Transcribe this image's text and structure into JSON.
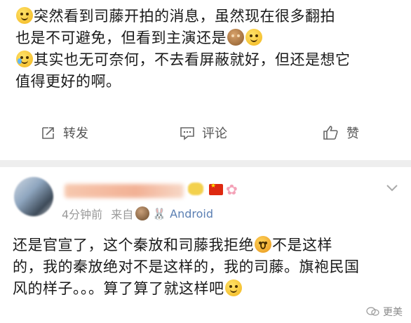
{
  "post": {
    "lines": [
      {
        "emoji_before": "smile-emoji",
        "text": "突然看到司藤开拍的消息，虽然现在很多翻拍"
      },
      {
        "text": "也是不可避免，但看到主演还是",
        "emoji_after": [
          "monkey-see-no-evil-emoji",
          "smile-emoji"
        ]
      },
      {
        "emoji_before": "crying-emoji",
        "text": "其实也无可奈何，不去看屏蔽就好，但还是想它"
      },
      {
        "text": "值得更好的啊。"
      }
    ]
  },
  "actions": {
    "repost": {
      "label": "转发",
      "icon": "share-icon"
    },
    "comment": {
      "label": "评论",
      "icon": "comment-icon"
    },
    "like": {
      "label": "赞",
      "icon": "thumbs-up-icon"
    }
  },
  "reply": {
    "meta": {
      "time": "4分钟前",
      "source_label": "来自",
      "source_device": "Android"
    },
    "lines": [
      {
        "text": "还是官宣了，这个秦放和司藤我拒绝",
        "emoji_after": [
          "screaming-emoji"
        ],
        "text_after": "不是这样"
      },
      {
        "text": "的，我的秦放绝对不是这样的，我的司藤。旗袍民国"
      },
      {
        "text": "风的样子。。。算了算了就这样吧",
        "emoji_after": [
          "shrug-emoji"
        ]
      }
    ]
  },
  "watermark": {
    "text": "更美"
  },
  "colors": {
    "card_bg": "#ffffff",
    "page_bg": "#f4f4f4",
    "text": "#1a1a1a",
    "meta": "#9a9a9a",
    "source_link": "#5b7fb3"
  }
}
